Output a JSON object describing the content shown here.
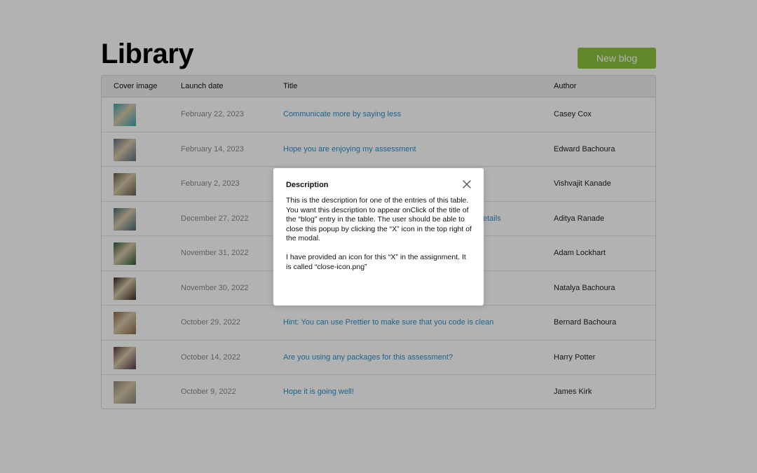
{
  "header": {
    "title": "Library",
    "new_blog_label": "New blog"
  },
  "colors": {
    "accent_button": "#8bc43f",
    "link": "#2b8fc8",
    "date_text": "#8a8a8a",
    "overlay": "rgba(0,0,0,0.30)"
  },
  "table": {
    "columns": [
      "Cover image",
      "Launch date",
      "Title",
      "Author"
    ],
    "rows": [
      {
        "date": "February 22, 2023",
        "title": "Communicate more by saying less",
        "author": "Casey Cox",
        "thumb_color": "#3aa5b5"
      },
      {
        "date": "February 14, 2023",
        "title": "Hope you are enjoying my assessment",
        "author": "Edward Bachoura",
        "thumb_color": "#5a6e82"
      },
      {
        "date": "February 2, 2023",
        "title": "",
        "author": "Vishvajit Kanade",
        "thumb_color": "#6b5a4a"
      },
      {
        "date": "December 27, 2022",
        "title": "etails",
        "author": "Aditya Ranade",
        "thumb_color": "#4a6a7a"
      },
      {
        "date": "November 31, 2022",
        "title": "",
        "author": "Adam Lockhart",
        "thumb_color": "#2f5a3a"
      },
      {
        "date": "November 30, 2022",
        "title": "",
        "author": "Natalya Bachoura",
        "thumb_color": "#3a2a22"
      },
      {
        "date": "October 29, 2022",
        "title": "Hint: You can use Prettier to make sure that you code is clean",
        "author": "Bernard Bachoura",
        "thumb_color": "#8a6a4a"
      },
      {
        "date": "October 14, 2022",
        "title": "Are you using any packages for this assessment?",
        "author": "Harry Potter",
        "thumb_color": "#5a3a4a"
      },
      {
        "date": "October 9, 2022",
        "title": "Hope it is going well!",
        "author": "James Kirk",
        "thumb_color": "#8a8478"
      }
    ]
  },
  "modal": {
    "title": "Description",
    "close_icon": "close-icon",
    "paragraph_1": "This is the description for one of the entries of this table. You want this description to appear onClick of the title of the “blog” entry in the table. The user should be able to close this popup by clicking the “X” icon in the top right of the modal.",
    "paragraph_2": "I have provided an icon for this “X” in the assignment. It is called “close-icon.png”"
  }
}
